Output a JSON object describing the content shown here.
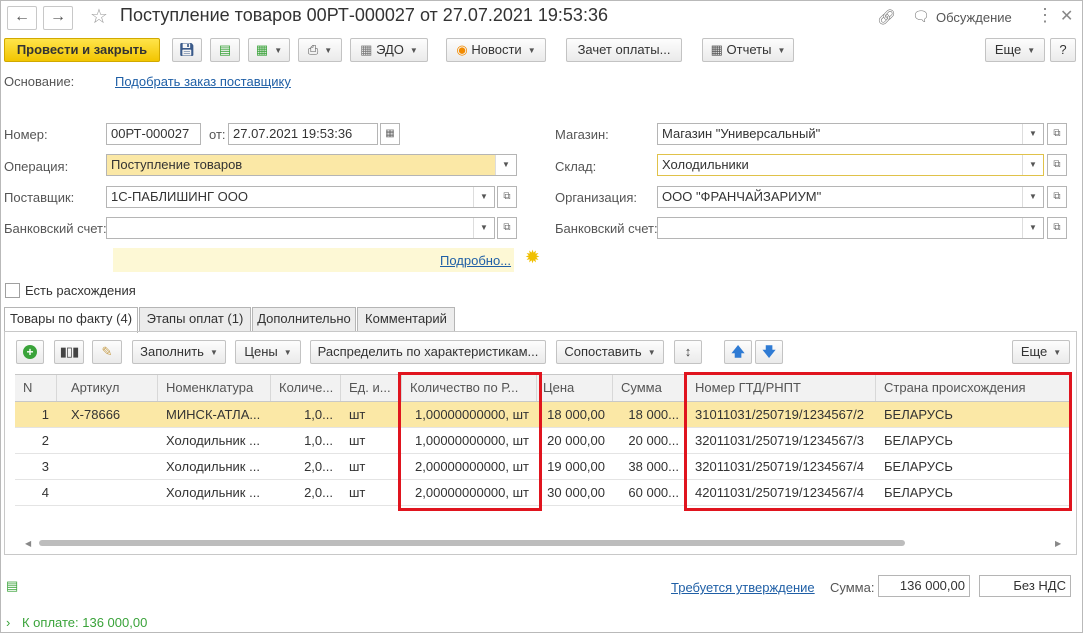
{
  "window": {
    "title": "Поступление товаров 00РТ-000027 от 27.07.2021 19:53:36",
    "discussion_label": "Обсуждение"
  },
  "toolbar": {
    "post_close": "Провести и закрыть",
    "edo": "ЭДО",
    "news": "Новости",
    "payment_offset": "Зачет оплаты...",
    "reports": "Отчеты",
    "more": "Еще",
    "help": "?"
  },
  "basis": {
    "label": "Основание:",
    "link": "Подобрать заказ поставщику"
  },
  "form": {
    "number_label": "Номер:",
    "number_value": "00РТ-000027",
    "date_label": "от:",
    "date_value": "27.07.2021 19:53:36",
    "operation_label": "Операция:",
    "operation_value": "Поступление товаров",
    "supplier_label": "Поставщик:",
    "supplier_value": "1С-ПАБЛИШИНГ ООО",
    "bank_left_label": "Банковский счет:",
    "bank_left_value": "",
    "store_label": "Магазин:",
    "store_value": "Магазин \"Универсальный\"",
    "warehouse_label": "Склад:",
    "warehouse_value": "Холодильники",
    "org_label": "Организация:",
    "org_value": "ООО \"ФРАНЧАЙЗАРИУМ\"",
    "bank_right_label": "Банковский счет:",
    "bank_right_value": "",
    "details_link": "Подробно...",
    "discrepancy_label": "Есть расхождения"
  },
  "tabs": [
    {
      "label": "Товары по факту (4)"
    },
    {
      "label": "Этапы оплат (1)"
    },
    {
      "label": "Дополнительно"
    },
    {
      "label": "Комментарий"
    }
  ],
  "table_toolbar": {
    "fill": "Заполнить",
    "prices": "Цены",
    "distribute": "Распределить по характеристикам...",
    "compare": "Сопоставить",
    "more": "Еще"
  },
  "table": {
    "columns": [
      "N",
      "Артикул",
      "Номенклатура",
      "Количе...",
      "Ед. и...",
      "Количество по Р...",
      "Цена",
      "Сумма",
      "Номер ГТД/РНПТ",
      "Страна происхождения"
    ],
    "rows": [
      {
        "n": "1",
        "article": "X-78666",
        "name": "МИНСК-АТЛА...",
        "qty": "1,0...",
        "unit": "шт",
        "qty_r": "1,00000000000, шт",
        "price": "18 000,00",
        "sum": "18 000...",
        "gtd": "31011031/250719/1234567/2",
        "country": "БЕЛАРУСЬ"
      },
      {
        "n": "2",
        "article": "",
        "name": "Холодильник ...",
        "qty": "1,0...",
        "unit": "шт",
        "qty_r": "1,00000000000, шт",
        "price": "20 000,00",
        "sum": "20 000...",
        "gtd": "32011031/250719/1234567/3",
        "country": "БЕЛАРУСЬ"
      },
      {
        "n": "3",
        "article": "",
        "name": "Холодильник ...",
        "qty": "2,0...",
        "unit": "шт",
        "qty_r": "2,00000000000, шт",
        "price": "19 000,00",
        "sum": "38 000...",
        "gtd": "32011031/250719/1234567/4",
        "country": "БЕЛАРУСЬ"
      },
      {
        "n": "4",
        "article": "",
        "name": "Холодильник ...",
        "qty": "2,0...",
        "unit": "шт",
        "qty_r": "2,00000000000, шт",
        "price": "30 000,00",
        "sum": "60 000...",
        "gtd": "42011031/250719/1234567/4",
        "country": "БЕЛАРУСЬ"
      }
    ]
  },
  "footer": {
    "approval_link": "Требуется утверждение",
    "sum_label": "Сумма:",
    "sum_value": "136 000,00",
    "vat_value": "Без НДС",
    "to_pay": "К оплате: 136 000,00"
  },
  "colors": {
    "accent_yellow": "#f2c500",
    "selection": "#fbe8a6",
    "highlight_red": "#e0141e",
    "link": "#1f5fa6",
    "green_icon": "#3aa33a"
  }
}
